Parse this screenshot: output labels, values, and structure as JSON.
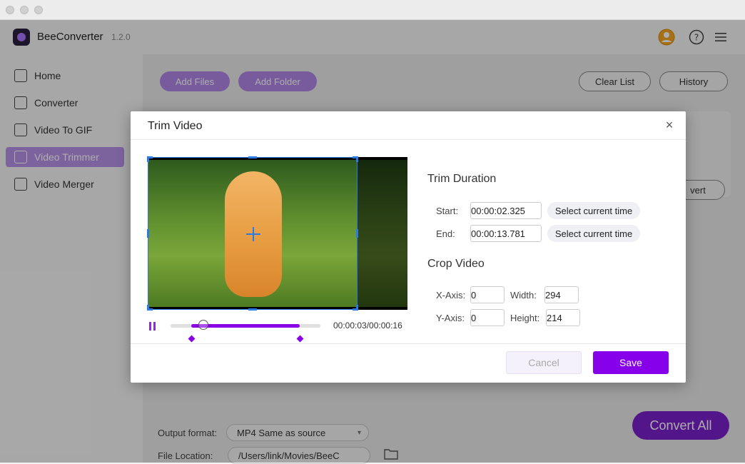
{
  "app": {
    "name": "BeeConverter",
    "version": "1.2.0"
  },
  "sidebar": {
    "items": [
      {
        "label": "Home",
        "icon": "home-icon"
      },
      {
        "label": "Converter",
        "icon": "converter-icon"
      },
      {
        "label": "Video To GIF",
        "icon": "gif-icon"
      },
      {
        "label": "Video Trimmer",
        "icon": "trim-icon",
        "active": true
      },
      {
        "label": "Video Merger",
        "icon": "merge-icon"
      }
    ]
  },
  "toolbar": {
    "add_files": "Add Files",
    "add_folder": "Add Folder",
    "clear_list": "Clear List",
    "history": "History",
    "convert_partial": "vert"
  },
  "bottom": {
    "output_format_label": "Output format:",
    "output_format_value": "MP4 Same as source",
    "file_location_label": "File Location:",
    "file_location_value": "/Users/link/Movies/BeeC",
    "convert_all": "Convert All"
  },
  "dialog": {
    "title": "Trim Video",
    "playback": {
      "current_time": "00:00:03",
      "total_time": "/00:00:16",
      "progress_start": 0.14,
      "progress_end": 0.86,
      "thumb_position": 0.22
    },
    "trim": {
      "title": "Trim Duration",
      "start_label": "Start:",
      "start_value": "00:00:02.325",
      "end_label": "End:",
      "end_value": "00:00:13.781",
      "select_current": "Select current time"
    },
    "crop": {
      "title": "Crop Video",
      "x_label": "X-Axis:",
      "x_value": "0",
      "y_label": "Y-Axis:",
      "y_value": "0",
      "width_label": "Width:",
      "width_value": "294",
      "height_label": "Height:",
      "height_value": "214"
    },
    "cancel": "Cancel",
    "save": "Save"
  },
  "colors": {
    "accent": "#8600ea",
    "sidebar_active": "#b892e8",
    "crop_border": "#2c7be5"
  }
}
